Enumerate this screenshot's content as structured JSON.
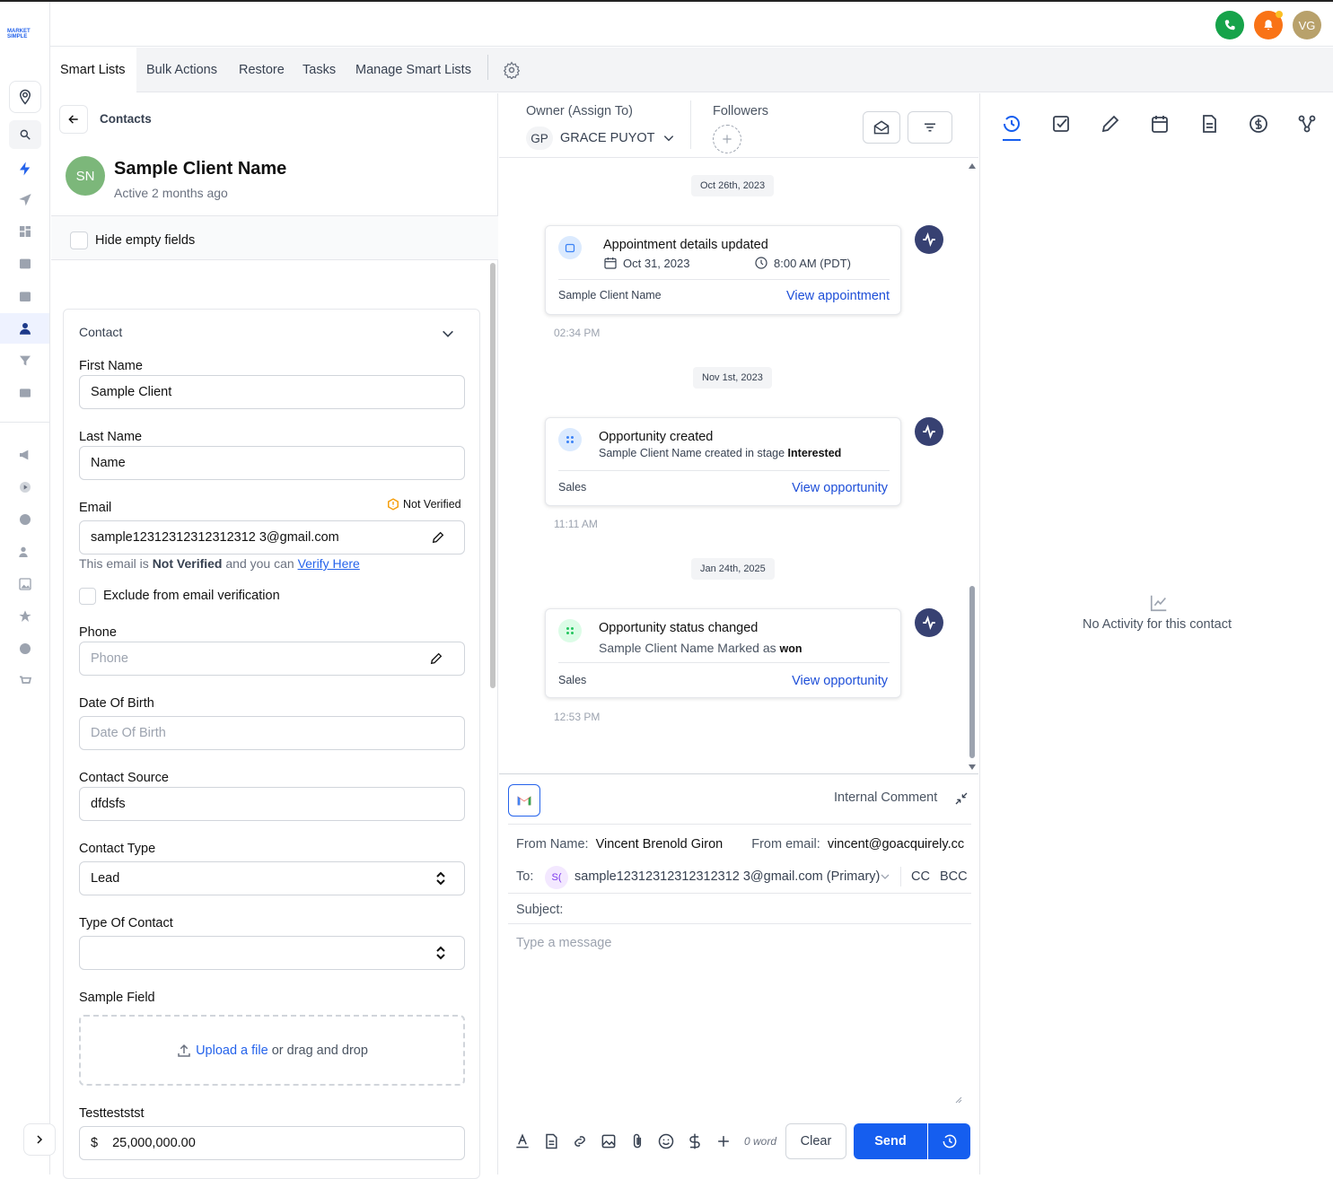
{
  "brand": {
    "logo_text": "MARKET SIMPLE"
  },
  "header": {
    "avatar_initials": "VG"
  },
  "colors": {
    "primary": "#155eef",
    "phone": "#16a34a",
    "bell": "#f97316",
    "avatar": "#b8a16b",
    "contact_avatar": "#7cb77a",
    "activity_dot": "#374172"
  },
  "tabs": [
    {
      "label": "Smart Lists",
      "active": true
    },
    {
      "label": "Bulk Actions"
    },
    {
      "label": "Restore"
    },
    {
      "label": "Tasks"
    },
    {
      "label": "Manage Smart Lists"
    }
  ],
  "contact": {
    "back_label": "Contacts",
    "initials": "SN",
    "name": "Sample Client Name",
    "status": "Active 2 months ago",
    "hide_empty": "Hide empty fields",
    "section": "Contact",
    "first_name_label": "First Name",
    "first_name": "Sample Client",
    "last_name_label": "Last Name",
    "last_name": "Name",
    "email_label": "Email",
    "email_status": "Not Verified",
    "email": "sample12312312312312312 3@gmail.com",
    "email_note_pre": "This email is",
    "email_note_bold": "Not Verified",
    "email_note_mid": "and you can",
    "email_note_link": "Verify Here",
    "exclude_label": "Exclude from email verification",
    "phone_label": "Phone",
    "phone_placeholder": "Phone",
    "dob_label": "Date Of Birth",
    "dob_placeholder": "Date Of Birth",
    "source_label": "Contact Source",
    "source": "dfdsfs",
    "type_label": "Contact Type",
    "type": "Lead",
    "type_of_label": "Type Of Contact",
    "type_of": "",
    "sample_field_label": "Sample Field",
    "upload_link": "Upload a file",
    "upload_rest": "or drag and drop",
    "testtest_label": "Testteststst",
    "currency": "$",
    "testtest_value": "25,000,000.00"
  },
  "conversation": {
    "owner_label": "Owner (Assign To)",
    "owner_initials": "GP",
    "owner_name": "GRACE PUYOT",
    "followers_label": "Followers",
    "events": [
      {
        "date": "Oct 26th, 2023",
        "title": "Appointment details updated",
        "date_val": "Oct 31, 2023",
        "time_val": "8:00 AM (PDT)",
        "footer": "Sample Client Name",
        "link": "View appointment",
        "time": "02:34 PM"
      },
      {
        "date": "Nov 1st, 2023",
        "title": "Opportunity created",
        "sub": "Sample Client Name created in stage",
        "sub_bold": "Interested",
        "footer": "Sales",
        "link": "View opportunity",
        "time": "11:11 AM"
      },
      {
        "date": "Jan 24th, 2025",
        "title": "Opportunity status changed",
        "sub": "Sample Client Name Marked as",
        "sub_bold": "won",
        "footer": "Sales",
        "link": "View opportunity",
        "time": "12:53 PM"
      }
    ]
  },
  "composer": {
    "internal_comment": "Internal Comment",
    "from_name_label": "From Name:",
    "from_name": "Vincent Brenold Giron",
    "from_email_label": "From email:",
    "from_email": "vincent@goacquirely.cc",
    "to_label": "To:",
    "to_chip": "S(",
    "to_value": "sample12312312312312312 3@gmail.com (Primary)",
    "cc": "CC",
    "bcc": "BCC",
    "subject_label": "Subject:",
    "message_placeholder": "Type a message",
    "word_count": "0 word",
    "clear": "Clear",
    "send": "Send"
  },
  "activity": {
    "empty": "No Activity for this contact"
  }
}
